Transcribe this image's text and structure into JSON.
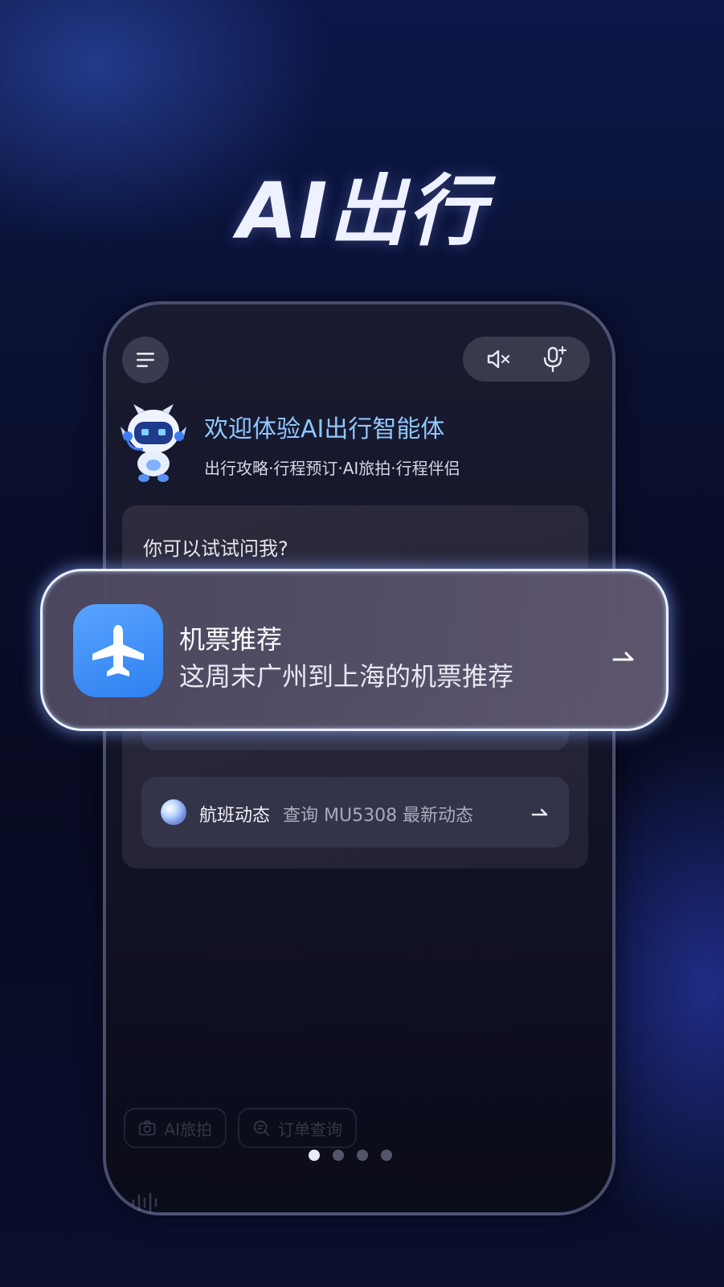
{
  "hero_title": "AI出行",
  "welcome": {
    "title": "欢迎体验AI出行智能体",
    "subtitle": "出行攻略·行程预订·AI旅拍·行程伴侣"
  },
  "icons": {
    "menu": "menu-icon",
    "mute": "speaker-mute-icon",
    "mic": "microphone-add-icon",
    "plane": "airplane-icon",
    "camera": "camera-icon",
    "order": "order-search-icon",
    "voice": "voice-wave-icon"
  },
  "suggestions": {
    "title": "你可以试试问我?",
    "featured": {
      "title": "机票推荐",
      "subtitle": "这周末广州到上海的机票推荐"
    },
    "cards": [
      {
        "title": "航班动态",
        "subtitle": "查询 MU5308 最新动态"
      }
    ]
  },
  "chips": [
    {
      "label": "AI旅拍"
    },
    {
      "label": "订单查询"
    }
  ],
  "pager": {
    "count": 4,
    "active": 1
  },
  "colors": {
    "accent_blue": "#2f80f0",
    "welcome_title": "#8fc7ff",
    "background_dark": "#080b22"
  }
}
